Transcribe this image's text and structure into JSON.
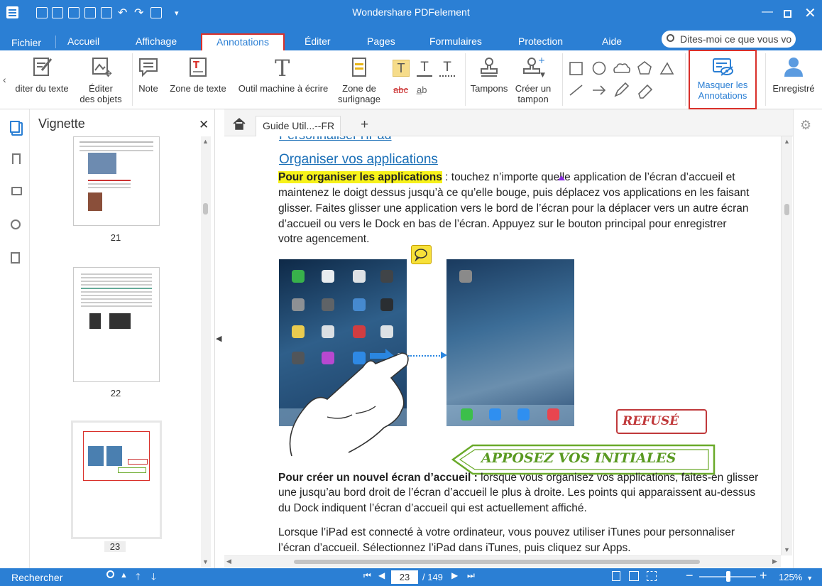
{
  "app": {
    "title": "Wondershare PDFelement"
  },
  "menu": {
    "tabs": [
      {
        "label": "Fichier"
      },
      {
        "label": "Accueil"
      },
      {
        "label": "Affichage"
      },
      {
        "label": "Annotations"
      },
      {
        "label": "Éditer"
      },
      {
        "label": "Pages"
      },
      {
        "label": "Formulaires"
      },
      {
        "label": "Protection"
      },
      {
        "label": "Aide"
      }
    ],
    "search_placeholder": "Dites-moi ce que vous vo",
    "active_tab": "Annotations"
  },
  "ribbon": {
    "edit_text": "diter du texte",
    "edit_objects": [
      "Éditer",
      "des objets"
    ],
    "note": "Note",
    "text_box": "Zone de texte",
    "typewriter": "Outil machine à écrire",
    "highlight_area": [
      "Zone de",
      "surlignage"
    ],
    "stamps": "Tampons",
    "create_stamp": [
      "Créer un",
      "tampon"
    ],
    "hide_annotations": [
      "Masquer les",
      "Annotations"
    ],
    "saved": "Enregistré",
    "text_marks": [
      "T",
      "T",
      "T",
      "abc",
      "a̲b"
    ]
  },
  "left_panel": {
    "title": "Vignette",
    "thumbnails": [
      {
        "page": "21"
      },
      {
        "page": "22"
      },
      {
        "page": "23"
      }
    ],
    "active_page": "23"
  },
  "doc": {
    "tab_label": "Guide Util...--FR",
    "heading_partial": "Personnaliser l'iPad",
    "heading": "Organiser vos applications",
    "para1_bold": "Pour organiser les applications",
    "para1_lines": [
      " : touchez n’importe quelle application de l’écran d’accueil et",
      "maintenez le doigt dessus jusqu’à ce qu’elle bouge, puis déplacez vos applications en les faisant",
      "glisser. Faites glisser une application vers le bord de l’écran pour la déplacer vers un autre écran",
      "d’accueil ou vers le Dock en bas de l’écran. Appuyez sur le bouton principal pour enregistrer",
      "votre agencement."
    ],
    "stamp_refused": "REFUSÉ",
    "stamp_initials": "APPOSEZ VOS INITIALES",
    "para2_bold": "Pour créer un nouvel écran d’accueil :",
    "para2_lines": [
      " lorsque vous organisez vos applications, faites-en glisser",
      "une jusqu’au bord droit de l’écran d’accueil le plus à droite. Les points qui apparaissent au-dessus",
      "du Dock indiquent l’écran d’accueil qui est actuellement affiché."
    ],
    "para3_lines": [
      "Lorsque l’iPad est connecté à votre ordinateur, vous pouvez utiliser iTunes pour personnaliser",
      "l’écran d’accueil. Sélectionnez l’iPad dans iTunes, puis cliquez sur Apps."
    ]
  },
  "status": {
    "search_label": "Rechercher",
    "current_page": "23",
    "total_pages": "/ 149",
    "zoom": "125%"
  },
  "colors": {
    "accent": "#2b7fd4",
    "highlight_box": "#d9302a",
    "stamp_red": "#c0393b",
    "stamp_green": "#6aaa2a",
    "text_highlight": "#f7f21a"
  }
}
